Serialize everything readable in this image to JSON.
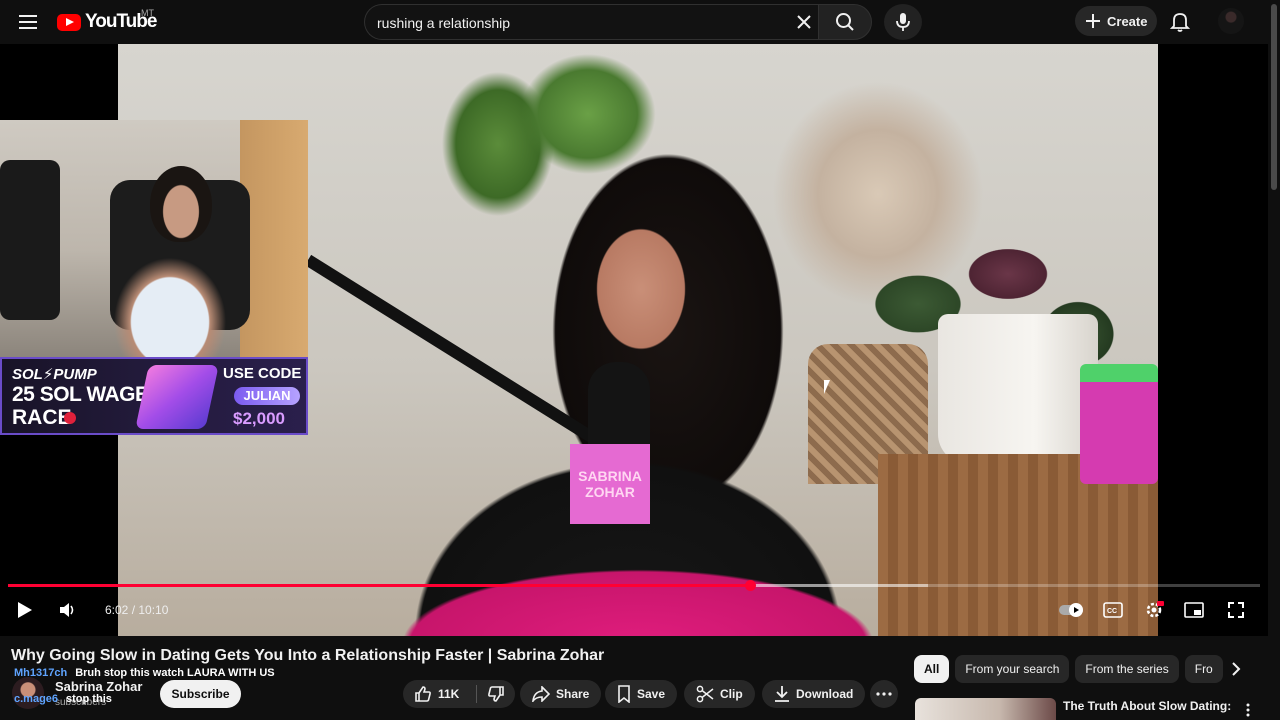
{
  "header": {
    "logo_text": "YouTube",
    "region_code": "MT",
    "search_value": "rushing a relationship",
    "create_label": "Create"
  },
  "player": {
    "current_time": "6:02",
    "duration": "10:10",
    "time_display": "6:02 / 10:10",
    "played_fraction": 0.593,
    "buffered_fraction": 0.735,
    "mic_flag_line1": "SABRINA",
    "mic_flag_line2": "ZOHAR",
    "promo": {
      "brand": "SOL⚡PUMP",
      "line1": "25 SOL WAGER",
      "line2": "RACE",
      "use_code": "USE CODE",
      "code": "JULIAN",
      "prize": "$2,000"
    }
  },
  "video": {
    "title": "Why Going Slow in Dating Gets You Into a Relationship Faster | Sabrina Zohar",
    "channel_name": "Sabrina Zohar",
    "subscribers": "subscribers",
    "subscribe_label": "Subscribe",
    "likes": "11K",
    "share_label": "Share",
    "save_label": "Save",
    "clip_label": "Clip",
    "download_label": "Download"
  },
  "chat_overlay": [
    {
      "user": "Mh1317ch",
      "message": "Bruh stop this watch LAURA WITH US"
    },
    {
      "user": "c.mage6",
      "message": "stop this"
    }
  ],
  "sidebar": {
    "chips": [
      "All",
      "From your search",
      "From the series",
      "Fro"
    ],
    "active_chip": "All",
    "recommendation_title": "The Truth About Slow Dating:"
  },
  "colors": {
    "brand_red": "#ff0000",
    "progress_red": "#ff0033",
    "background": "#0f0f0f",
    "pill_bg": "#272727"
  }
}
